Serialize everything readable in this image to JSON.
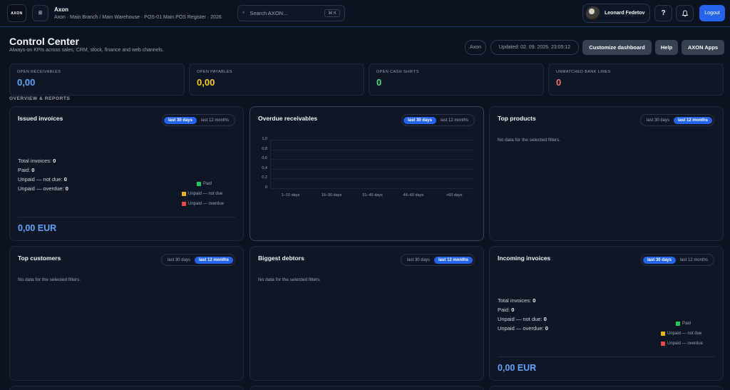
{
  "topbar": {
    "logo_text": "AXON",
    "menu_icon": "menu-icon",
    "brand_title": "Axon",
    "brand_sub": "Axon · Main Branch / Main Warehouse · POS-01 Main POS Register · 2026",
    "search_placeholder": "Search AXON...",
    "search_shortcut": "⌘ K",
    "user_name": "Leonard Fedetov",
    "help_label": "?",
    "notifications_icon": "bell-icon",
    "logout_label": "Logout"
  },
  "header": {
    "title": "Control Center",
    "subtitle": "Always-on KPIs across sales, CRM, stock, finance and web channels.",
    "tenant_pill": "Axon",
    "updated": "Updated: 02. 09. 2026. 23:05:12",
    "customize_label": "Customize dashboard",
    "help_label": "Help",
    "apps_label": "AXON Apps"
  },
  "kpis": [
    {
      "label": "OPEN RECEIVABLES",
      "value": "0,00",
      "color": "#60a5fa"
    },
    {
      "label": "OPEN PAYABLES",
      "value": "0,00",
      "color": "#facc15"
    },
    {
      "label": "OPEN CASH SHIFTS",
      "value": "0",
      "color": "#4ade80"
    },
    {
      "label": "UNMATCHED BANK LINES",
      "value": "0",
      "color": "#f87171"
    }
  ],
  "section_title": "OVERVIEW & REPORTS",
  "ranges": {
    "a": "last 30 days",
    "b": "last 12 months"
  },
  "empty_text": "No data for the selected filters.",
  "invoice_summary": {
    "total_label": "Total invoices:",
    "total": "0",
    "paid_label": "Paid:",
    "paid": "0",
    "notdue_label": "Unpaid — not due:",
    "notdue": "0",
    "overdue_label": "Unpaid — overdue:",
    "overdue": "0",
    "legend": [
      "Paid",
      "Unpaid — not due",
      "Unpaid — overdue"
    ]
  },
  "legend_colors": [
    "#22c55e",
    "#eab308",
    "#ef4444"
  ],
  "cards": {
    "issued": {
      "title": "Issued invoices",
      "amount": "0,00 EUR"
    },
    "overdue": {
      "title": "Overdue receivables"
    },
    "top_products": {
      "title": "Top products"
    },
    "top_customers": {
      "title": "Top customers"
    },
    "debtors": {
      "title": "Biggest debtors"
    },
    "incoming": {
      "title": "Incoming invoices",
      "amount": "0,00 EUR"
    }
  },
  "chart_data": {
    "type": "bar",
    "title": "Overdue receivables",
    "categories": [
      "1–15 days",
      "16–30 days",
      "31–45 days",
      "46–60 days",
      ">60 days"
    ],
    "values": [
      0,
      0,
      0,
      0,
      0
    ],
    "ylim": [
      0,
      1
    ],
    "yticks": [
      "1,0",
      "0,8",
      "0,6",
      "0,4",
      "0,2",
      "0"
    ],
    "grid": true,
    "xlabel": "",
    "ylabel": ""
  }
}
